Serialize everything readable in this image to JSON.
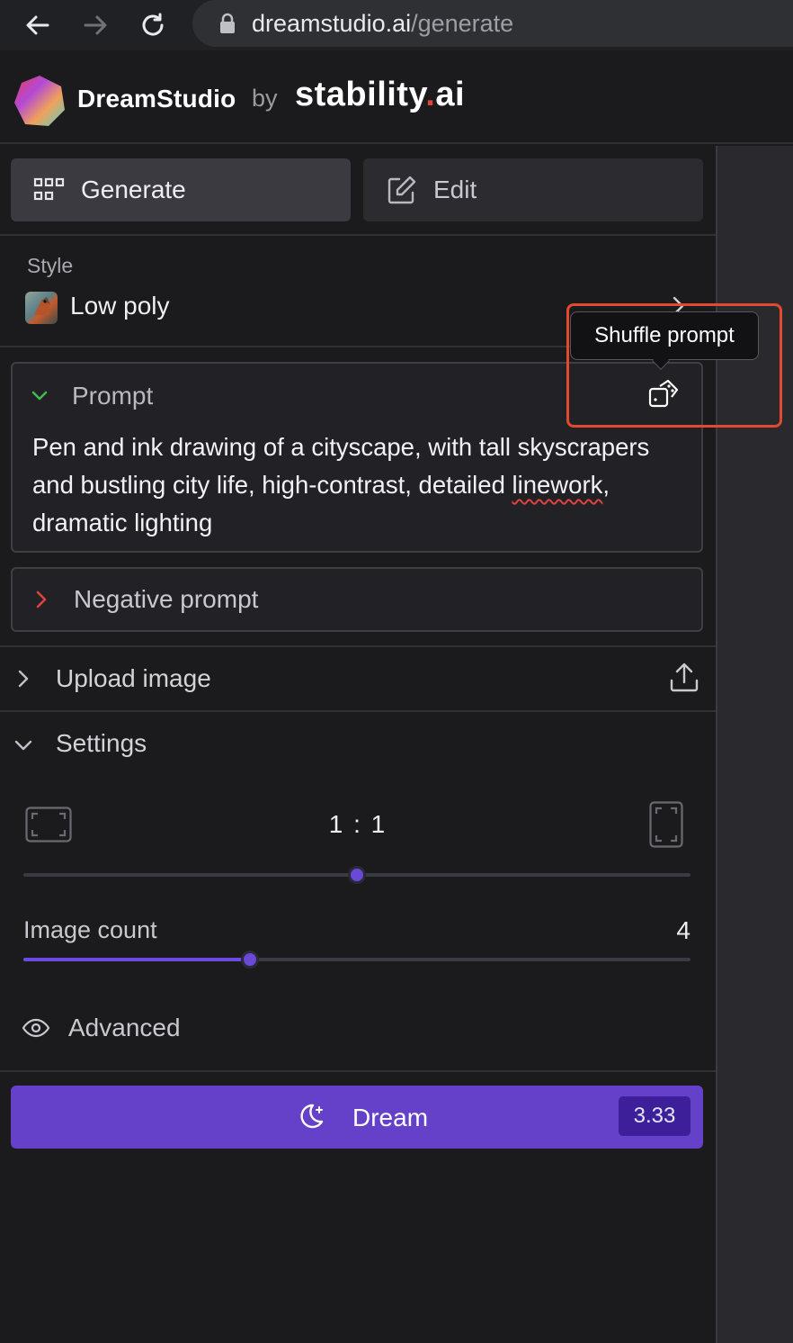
{
  "browser": {
    "url_host": "dreamstudio.ai",
    "url_path": "/generate"
  },
  "header": {
    "brand": "DreamStudio",
    "by": "by",
    "company": "stability",
    "company_dot": ".",
    "company_suffix": "ai"
  },
  "tabs": [
    {
      "label": "Generate",
      "icon": "grid-icon",
      "active": true
    },
    {
      "label": "Edit",
      "icon": "edit-icon",
      "active": false
    }
  ],
  "style": {
    "label": "Style",
    "value": "Low poly"
  },
  "prompt": {
    "title": "Prompt",
    "text_before": "Pen and ink drawing of a cityscape, with tall skyscrapers and bustling city life, high-contrast, detailed ",
    "text_misspelled": "linework",
    "text_after": ", dramatic lighting",
    "tooltip": "Shuffle prompt"
  },
  "negative_prompt": {
    "title": "Negative prompt"
  },
  "upload": {
    "title": "Upload image"
  },
  "settings": {
    "title": "Settings",
    "aspect_ratio": "1 : 1",
    "aspect_slider_fraction": 0.5,
    "image_count_label": "Image count",
    "image_count": "4",
    "image_count_fraction": 0.34,
    "advanced_label": "Advanced"
  },
  "dream": {
    "label": "Dream",
    "cost": "3.33"
  },
  "colors": {
    "accent": "#6441c8",
    "cost_badge": "#3d1f99",
    "highlight": "#e04a2f",
    "prompt_caret": "#3fb950",
    "negative_caret": "#e0433d"
  }
}
